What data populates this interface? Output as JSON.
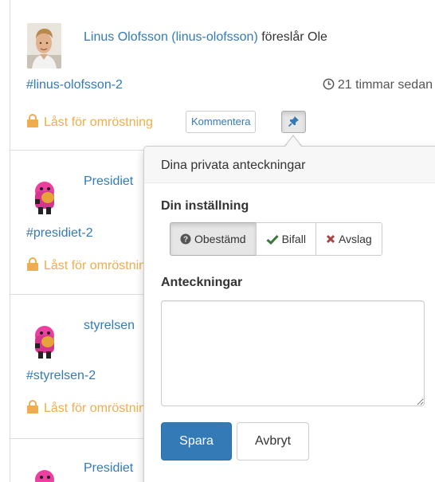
{
  "items": [
    {
      "author_name": "Linus Olofsson",
      "author_handle": "(linus-olofsson)",
      "action": "föreslår Ole",
      "anchor": "#linus-olofsson-2",
      "time": "21 timmar sedan",
      "locked": "Låst för omröstning",
      "comment_button": "Kommentera"
    },
    {
      "author_name": "Presidiet",
      "anchor": "#presidiet-2",
      "locked": "Låst för omröstning"
    },
    {
      "author_name": "styrelsen",
      "anchor": "#styrelsen-2",
      "locked": "Låst för omröstning"
    },
    {
      "author_name": "Presidiet"
    }
  ],
  "popover": {
    "title": "Dina privata anteckningar",
    "stance_label": "Din inställning",
    "stance_options": [
      {
        "label": "Obestämd",
        "icon": "question-circle-icon",
        "color": "#333333",
        "selected": true
      },
      {
        "label": "Bifall",
        "icon": "check-icon",
        "color": "#3c763d",
        "selected": false
      },
      {
        "label": "Avslag",
        "icon": "times-icon",
        "color": "#a94442",
        "selected": false
      }
    ],
    "notes_label": "Anteckningar",
    "notes_value": "",
    "save_button": "Spara",
    "cancel_button": "Avbryt"
  },
  "colors": {
    "link": "#337ab7",
    "locked": "#f0ad4e",
    "primary": "#337ab7"
  }
}
